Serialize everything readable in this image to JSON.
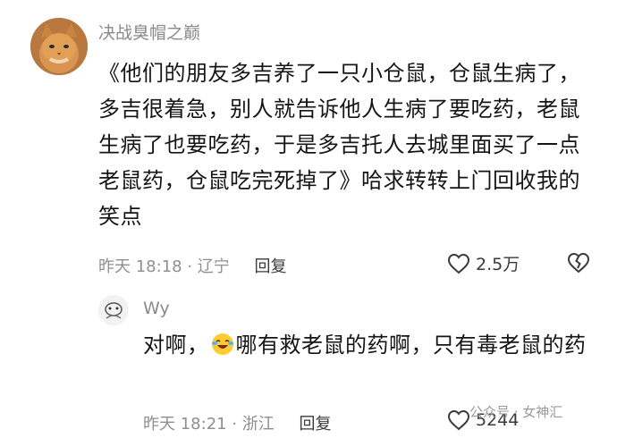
{
  "comment": {
    "username": "决战臭帽之巅",
    "text": "《他们的朋友多吉养了一只小仓鼠，仓鼠生病了，多吉很着急，别人就告诉他人生病了要吃药，老鼠生病了也要吃药，于是多吉托人去城里面买了一点老鼠药，仓鼠吃完死掉了》哈求转转上门回收我的笑点",
    "time": "昨天 18:18 · 辽宁",
    "reply_label": "回复",
    "likes": "2.5万",
    "avatar_icon": "cat-avatar-icon"
  },
  "reply": {
    "username": "Wy",
    "text_before": "对啊，",
    "emoji_icon": "laughing-tears-emoji",
    "text_after": "哪有救老鼠的药啊，只有毒老鼠的药",
    "time": "昨天 18:21 · 浙江",
    "reply_label": "回复",
    "likes": "5244"
  },
  "watermark": "公众号 · 女神汇"
}
